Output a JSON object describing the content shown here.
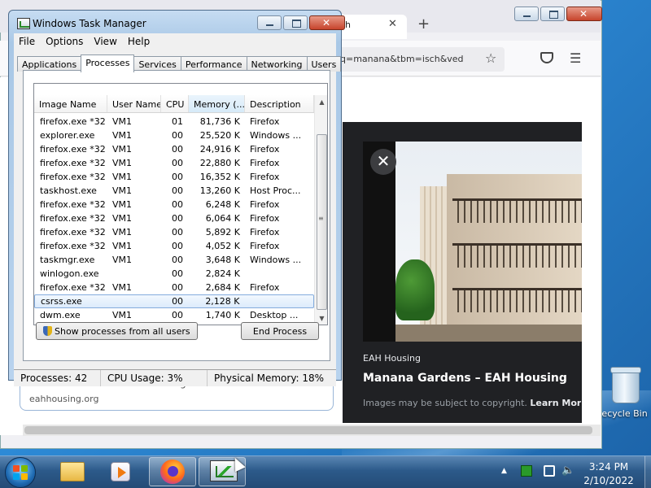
{
  "browser": {
    "tab_title": "ch",
    "url": "q=manana&tbm=isch&ved",
    "result": {
      "title": "Manana Gardens – EAH Housing",
      "site": "eahhousing.org"
    },
    "viewer": {
      "source": "EAH Housing",
      "title": "Manana Gardens – EAH Housing",
      "copyright": "Images may be subject to copyright.",
      "learn_more": "Learn More"
    }
  },
  "task_manager": {
    "title": "Windows Task Manager",
    "menu": [
      "File",
      "Options",
      "View",
      "Help"
    ],
    "tabs": [
      "Applications",
      "Processes",
      "Services",
      "Performance",
      "Networking",
      "Users"
    ],
    "active_tab": "Processes",
    "columns": [
      "Image Name",
      "User Name",
      "CPU",
      "Memory (...",
      "Description"
    ],
    "processes": [
      {
        "name": "firefox.exe *32",
        "user": "VM1",
        "cpu": "01",
        "memory": "81,736 K",
        "description": "Firefox"
      },
      {
        "name": "explorer.exe",
        "user": "VM1",
        "cpu": "00",
        "memory": "25,520 K",
        "description": "Windows ..."
      },
      {
        "name": "firefox.exe *32",
        "user": "VM1",
        "cpu": "00",
        "memory": "24,916 K",
        "description": "Firefox"
      },
      {
        "name": "firefox.exe *32",
        "user": "VM1",
        "cpu": "00",
        "memory": "22,880 K",
        "description": "Firefox"
      },
      {
        "name": "firefox.exe *32",
        "user": "VM1",
        "cpu": "00",
        "memory": "16,352 K",
        "description": "Firefox"
      },
      {
        "name": "taskhost.exe",
        "user": "VM1",
        "cpu": "00",
        "memory": "13,260 K",
        "description": "Host Proc..."
      },
      {
        "name": "firefox.exe *32",
        "user": "VM1",
        "cpu": "00",
        "memory": "6,248 K",
        "description": "Firefox"
      },
      {
        "name": "firefox.exe *32",
        "user": "VM1",
        "cpu": "00",
        "memory": "6,064 K",
        "description": "Firefox"
      },
      {
        "name": "firefox.exe *32",
        "user": "VM1",
        "cpu": "00",
        "memory": "5,892 K",
        "description": "Firefox"
      },
      {
        "name": "firefox.exe *32",
        "user": "VM1",
        "cpu": "00",
        "memory": "4,052 K",
        "description": "Firefox"
      },
      {
        "name": "taskmgr.exe",
        "user": "VM1",
        "cpu": "00",
        "memory": "3,648 K",
        "description": "Windows ..."
      },
      {
        "name": "winlogon.exe",
        "user": "",
        "cpu": "00",
        "memory": "2,824 K",
        "description": ""
      },
      {
        "name": "firefox.exe *32",
        "user": "VM1",
        "cpu": "00",
        "memory": "2,684 K",
        "description": "Firefox"
      },
      {
        "name": "csrss.exe",
        "user": "",
        "cpu": "00",
        "memory": "2,128 K",
        "description": ""
      },
      {
        "name": "dwm.exe",
        "user": "VM1",
        "cpu": "00",
        "memory": "1,740 K",
        "description": "Desktop ..."
      }
    ],
    "selected_process": "csrss.exe",
    "show_all_label": "Show processes from all users",
    "end_process_label": "End Process",
    "status": {
      "processes": "Processes: 42",
      "cpu": "CPU Usage: 3%",
      "memory": "Physical Memory: 18%"
    }
  },
  "desktop": {
    "recycle_bin_label": "Recycle Bin"
  },
  "taskbar": {
    "time": "3:24 PM",
    "date": "2/10/2022"
  },
  "colors": {
    "desktop": "#1d6fb5",
    "viewer_bg": "#202124",
    "selection": "#dcebfb"
  }
}
